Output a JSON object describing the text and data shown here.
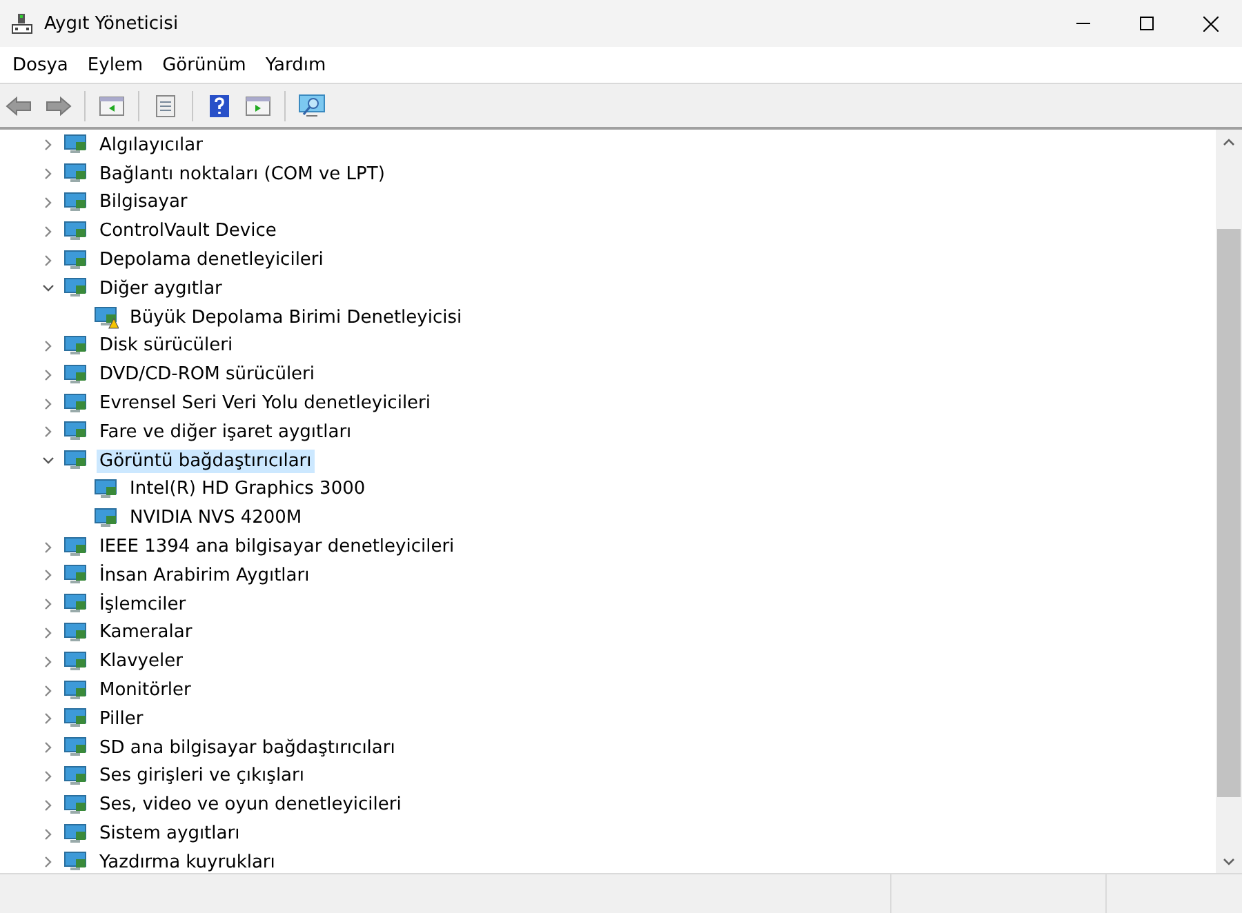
{
  "window": {
    "title": "Aygıt Yöneticisi"
  },
  "menu": [
    "Dosya",
    "Eylem",
    "Görünüm",
    "Yardım"
  ],
  "tree": [
    {
      "label": "Algılayıcılar",
      "expanded": false,
      "selected": false
    },
    {
      "label": "Bağlantı noktaları (COM ve LPT)",
      "expanded": false,
      "selected": false
    },
    {
      "label": "Bilgisayar",
      "expanded": false,
      "selected": false
    },
    {
      "label": "ControlVault Device",
      "expanded": false,
      "selected": false
    },
    {
      "label": "Depolama denetleyicileri",
      "expanded": false,
      "selected": false
    },
    {
      "label": "Diğer aygıtlar",
      "expanded": true,
      "selected": false,
      "children": [
        {
          "label": "Büyük Depolama Birimi Denetleyicisi",
          "selected": false,
          "warning": true
        }
      ]
    },
    {
      "label": "Disk sürücüleri",
      "expanded": false,
      "selected": false
    },
    {
      "label": "DVD/CD-ROM sürücüleri",
      "expanded": false,
      "selected": false
    },
    {
      "label": "Evrensel Seri Veri Yolu denetleyicileri",
      "expanded": false,
      "selected": false
    },
    {
      "label": "Fare ve diğer işaret aygıtları",
      "expanded": false,
      "selected": false
    },
    {
      "label": "Görüntü bağdaştırıcıları",
      "expanded": true,
      "selected": true,
      "children": [
        {
          "label": "Intel(R) HD Graphics 3000",
          "selected": false,
          "warning": false
        },
        {
          "label": "NVIDIA NVS 4200M",
          "selected": false,
          "warning": false
        }
      ]
    },
    {
      "label": "IEEE 1394 ana bilgisayar denetleyicileri",
      "expanded": false,
      "selected": false
    },
    {
      "label": "İnsan Arabirim Aygıtları",
      "expanded": false,
      "selected": false
    },
    {
      "label": "İşlemciler",
      "expanded": false,
      "selected": false
    },
    {
      "label": "Kameralar",
      "expanded": false,
      "selected": false
    },
    {
      "label": "Klavyeler",
      "expanded": false,
      "selected": false
    },
    {
      "label": "Monitörler",
      "expanded": false,
      "selected": false
    },
    {
      "label": "Piller",
      "expanded": false,
      "selected": false
    },
    {
      "label": "SD ana bilgisayar bağdaştırıcıları",
      "expanded": false,
      "selected": false
    },
    {
      "label": "Ses girişleri ve çıkışları",
      "expanded": false,
      "selected": false
    },
    {
      "label": "Ses, video ve oyun denetleyicileri",
      "expanded": false,
      "selected": false
    },
    {
      "label": "Sistem aygıtları",
      "expanded": false,
      "selected": false
    },
    {
      "label": "Yazdırma kuyrukları",
      "expanded": false,
      "selected": false
    }
  ]
}
